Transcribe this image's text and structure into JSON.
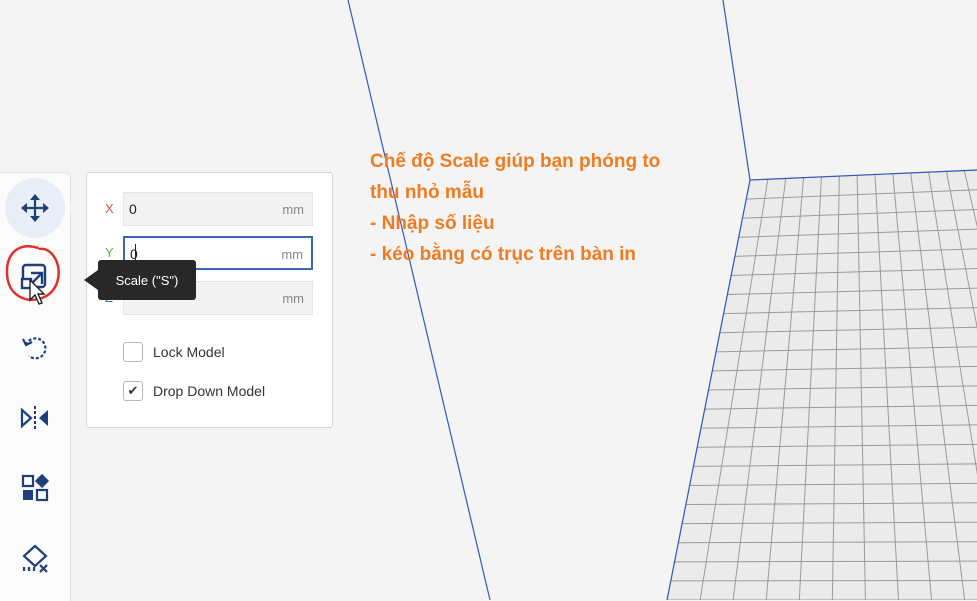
{
  "viewport": {
    "bed_color": "#ececec",
    "grid_color": "#9a9a9a",
    "edge_color": "#2a4fb0",
    "background_color": "#f4f4f4"
  },
  "toolbar": {
    "tools": [
      {
        "name": "move",
        "icon": "move-icon",
        "active": true
      },
      {
        "name": "scale",
        "icon": "scale-icon",
        "active": false,
        "highlighted": true
      },
      {
        "name": "rotate",
        "icon": "rotate-icon",
        "active": false
      },
      {
        "name": "mirror",
        "icon": "mirror-icon",
        "active": false
      },
      {
        "name": "per-model-settings",
        "icon": "per-model-settings-icon",
        "active": false
      },
      {
        "name": "support-blocker",
        "icon": "support-blocker-icon",
        "active": false
      }
    ]
  },
  "tooltip": {
    "text": "Scale (\"S\")"
  },
  "panel": {
    "x": {
      "label": "X",
      "value": "0",
      "unit": "mm",
      "color": "#d9534f"
    },
    "y": {
      "label": "Y",
      "value": "0",
      "unit": "mm",
      "color": "#5cb85c"
    },
    "z": {
      "label": "Z",
      "value": "",
      "unit": "mm",
      "color": "#3a66b5"
    },
    "lock_model": {
      "label": "Lock Model",
      "checked": false
    },
    "drop_down_model": {
      "label": "Drop Down Model",
      "checked": true
    }
  },
  "annotation": {
    "lines": [
      "Chế độ Scale giúp bạn phóng to",
      "thu nhỏ mẫu",
      "- Nhập số liệu",
      "- kéo bằng có trục trên bàn in"
    ],
    "color": "#f07c22",
    "highlight_color": "#e0302a"
  }
}
